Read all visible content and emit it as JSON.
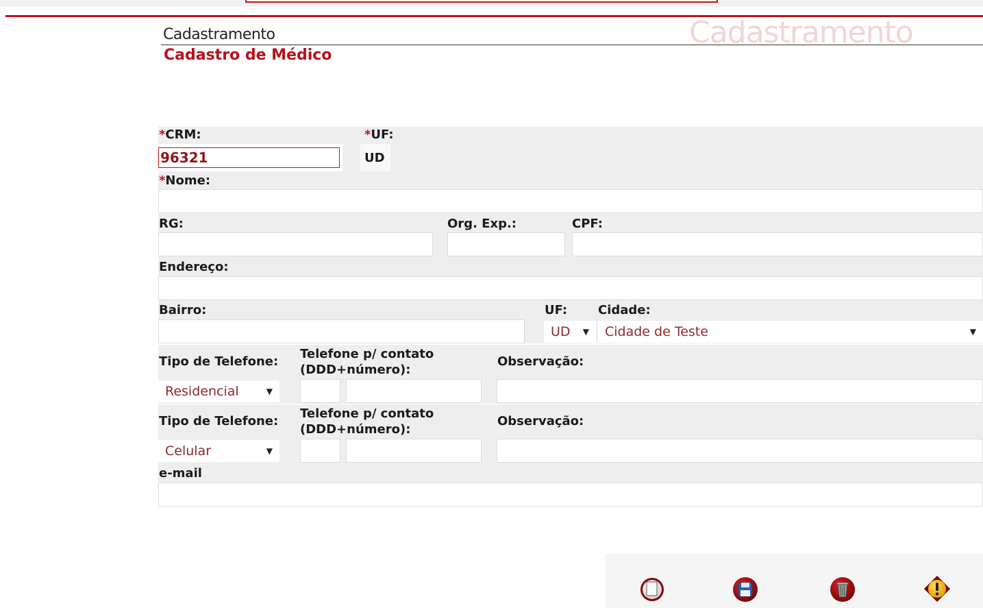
{
  "header": {
    "section_title": "Cadastramento",
    "watermark": "Cadastramento",
    "page_title": "Cadastro de Médico"
  },
  "form": {
    "crm": {
      "label": "CRM:",
      "value": "96321"
    },
    "uf_top": {
      "label": "UF:",
      "value": "UD"
    },
    "nome": {
      "label": "Nome:",
      "value": ""
    },
    "rg": {
      "label": "RG:",
      "value": ""
    },
    "org_exp": {
      "label": "Org. Exp.:",
      "value": ""
    },
    "cpf": {
      "label": "CPF:",
      "value": ""
    },
    "endereco": {
      "label": "Endereço:",
      "value": ""
    },
    "bairro": {
      "label": "Bairro:",
      "value": ""
    },
    "uf": {
      "label": "UF:",
      "value": "UD"
    },
    "cidade": {
      "label": "Cidade:",
      "value": "Cidade de Teste"
    },
    "phone1": {
      "type_label": "Tipo de Telefone:",
      "phone_label_line1": "Telefone p/ contato",
      "phone_label_line2": "(DDD+número):",
      "obs_label": "Observação:",
      "type_value": "Residencial",
      "ddd": "",
      "number": "",
      "obs": ""
    },
    "phone2": {
      "type_label": "Tipo de Telefone:",
      "phone_label_line1": "Telefone p/ contato",
      "phone_label_line2": "(DDD+número):",
      "obs_label": "Observação:",
      "type_value": "Celular",
      "ddd": "",
      "number": "",
      "obs": ""
    },
    "email": {
      "label": "e-mail",
      "value": ""
    },
    "required_marker": "*"
  },
  "actions": [
    {
      "name": "new",
      "icon": "new-document-icon"
    },
    {
      "name": "save",
      "icon": "floppy-disk-icon"
    },
    {
      "name": "delete",
      "icon": "trash-can-icon"
    },
    {
      "name": "warning",
      "icon": "warning-icon"
    }
  ],
  "colors": {
    "accent": "#b5121b",
    "value_text": "#8b1a1a",
    "row_bg": "#eeeeee"
  }
}
